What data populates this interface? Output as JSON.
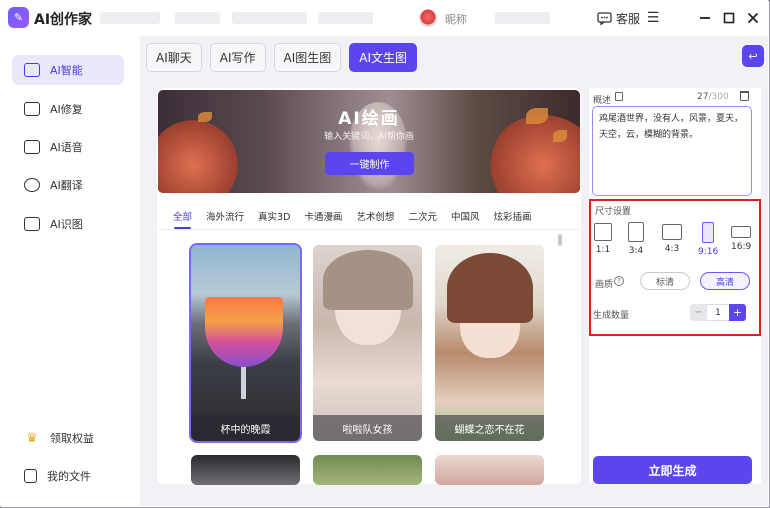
{
  "app": {
    "title": "AI创作家",
    "nickname": "昵称",
    "service_label": "客服"
  },
  "sidebar": {
    "items": [
      {
        "label": "AI智能",
        "icon": "ai-chat-icon"
      },
      {
        "label": "AI修复",
        "icon": "repair-icon"
      },
      {
        "label": "AI语音",
        "icon": "voice-icon"
      },
      {
        "label": "AI翻译",
        "icon": "translate-icon"
      },
      {
        "label": "AI识图",
        "icon": "image-recognition-icon"
      }
    ],
    "bottom": [
      {
        "label": "领取权益",
        "icon": "benefits-icon"
      },
      {
        "label": "我的文件",
        "icon": "file-icon"
      }
    ]
  },
  "tabs": [
    "AI聊天",
    "AI写作",
    "AI图生图",
    "AI文生图"
  ],
  "banner": {
    "title": "AI绘画",
    "subtitle": "输入关键词，AI帮你画",
    "button": "一键制作"
  },
  "categories": [
    "全部",
    "海外流行",
    "真实3D",
    "卡通漫画",
    "艺术创想",
    "二次元",
    "中国风",
    "炫彩插画"
  ],
  "cards": [
    {
      "caption": "杯中的晚霞"
    },
    {
      "caption": "啦啦队女孩"
    },
    {
      "caption": "蝴蝶之恋不在花"
    }
  ],
  "right_panel": {
    "desc_label": "概述",
    "count": "27",
    "max": "/300",
    "prompt": "鸡尾酒世界，没有人，风景，夏天，天空，云，模糊的背景。",
    "size_label": "尺寸设置",
    "ratios": [
      "1:1",
      "3:4",
      "4:3",
      "9:16",
      "16:9"
    ],
    "selected_ratio": "9:16",
    "quality_label": "画质",
    "quality_options": [
      "标清",
      "高清"
    ],
    "selected_quality": "高清",
    "quantity_label": "生成数量",
    "quantity": "1",
    "generate_button": "立即生成"
  },
  "colors": {
    "accent": "#5b46ee",
    "highlight_box": "#e0201e"
  }
}
